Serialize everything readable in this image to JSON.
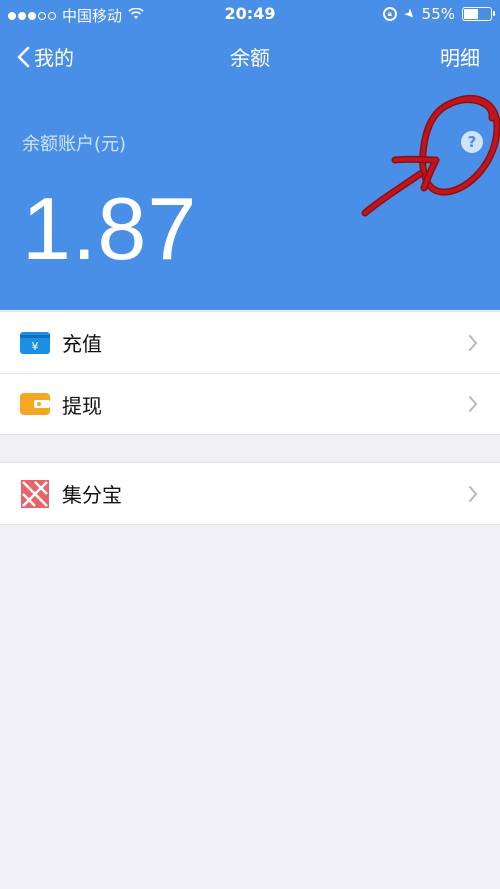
{
  "status_bar": {
    "carrier": "中国移动",
    "time": "20:49",
    "battery": "55%",
    "battery_level": 0.55
  },
  "nav": {
    "back_label": "我的",
    "title": "余额",
    "detail_label": "明细"
  },
  "balance": {
    "label": "余额账户(元)",
    "amount": "1.87",
    "help_symbol": "?"
  },
  "menu_group_1": [
    {
      "label": "充值",
      "icon": "recharge-icon"
    },
    {
      "label": "提现",
      "icon": "withdraw-icon"
    }
  ],
  "menu_group_2": [
    {
      "label": "集分宝",
      "icon": "jifenbao-icon"
    }
  ],
  "colors": {
    "header_blue": "#4a8fe7",
    "annotation_red": "#c0151b",
    "recharge_blue": "#1a8fe3",
    "withdraw_orange": "#f5a623",
    "jifenbao_red": "#e9636b"
  }
}
